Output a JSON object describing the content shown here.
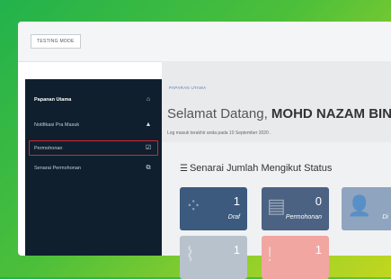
{
  "topbar": {
    "mode_label": "TESTING MODE"
  },
  "sidebar": {
    "items": [
      {
        "label": "Papanan Utama",
        "icon": "home-icon",
        "glyph": "⌂"
      },
      {
        "label": "Notifikasi Pra Masuk",
        "icon": "bell-icon",
        "glyph": "🔔"
      },
      {
        "label": "Permohonan",
        "icon": "checklist-icon",
        "glyph": "☑"
      },
      {
        "label": "Senarai Permohonan",
        "icon": "copy-icon",
        "glyph": "⧉"
      }
    ]
  },
  "main": {
    "breadcrumb": "PAPARAN UTAMA",
    "welcome_prefix": "Selamat Datang, ",
    "user_name": "MOHD NAZAM BIN",
    "last_login": "Log masuk terakhir anda pada 10 September 2020 ."
  },
  "status": {
    "title": "Senarai Jumlah Mengikut Status",
    "tiles": [
      {
        "count": "1",
        "caption": "Draf",
        "color": "#3b5a7e",
        "icon": "spinner-icon"
      },
      {
        "count": "0",
        "caption": "Permohonan",
        "color": "#4b6283",
        "icon": "id-card-icon"
      },
      {
        "count": "",
        "caption": "Di",
        "color": "#8fa4bf",
        "icon": "user-plus-icon"
      },
      {
        "count": "1",
        "caption": "",
        "color": "#b8c2cc",
        "icon": "chart-icon"
      },
      {
        "count": "1",
        "caption": "",
        "color": "#f2a6a2",
        "icon": "alert-icon"
      }
    ]
  },
  "colors": {
    "sidebar_bg": "#0f1f2e",
    "highlight_border": "#d8262f",
    "breadcrumb": "#5a7ea8"
  }
}
